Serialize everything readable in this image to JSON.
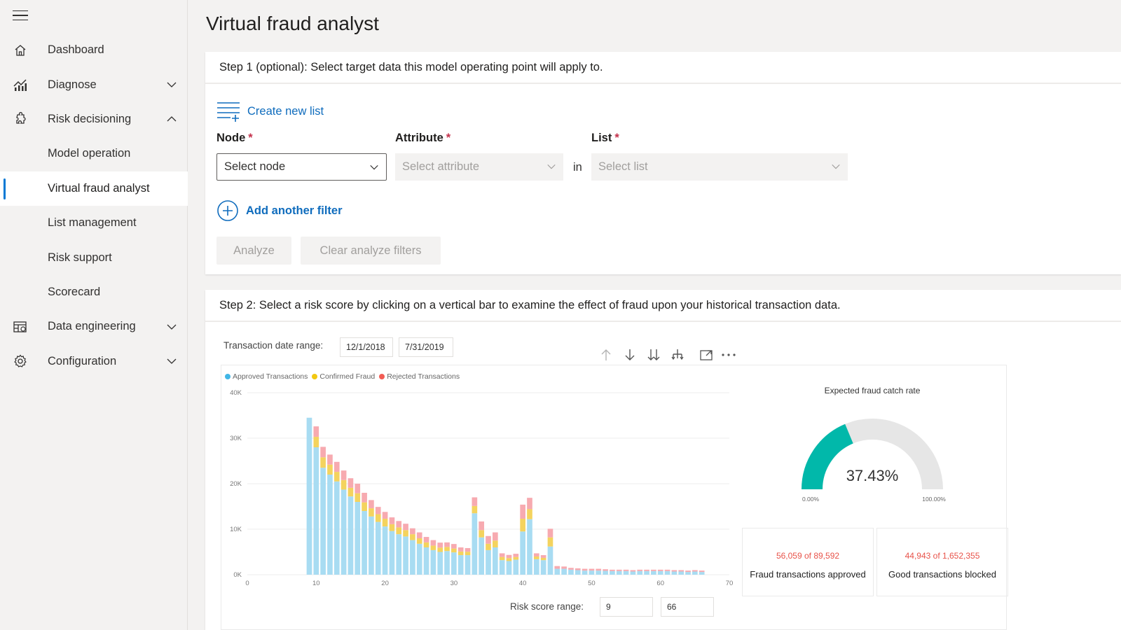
{
  "page": {
    "title": "Virtual fraud analyst"
  },
  "sidebar": {
    "items": [
      {
        "label": "Dashboard",
        "icon": "home-icon"
      },
      {
        "label": "Diagnose",
        "icon": "chart-icon",
        "chevron": "down"
      },
      {
        "label": "Risk decisioning",
        "icon": "puzzle-icon",
        "chevron": "up"
      },
      {
        "label": "Model operation"
      },
      {
        "label": "Virtual fraud analyst",
        "active": true
      },
      {
        "label": "List management"
      },
      {
        "label": "Risk support"
      },
      {
        "label": "Scorecard"
      },
      {
        "label": "Data engineering",
        "icon": "table-icon",
        "chevron": "down"
      },
      {
        "label": "Configuration",
        "icon": "gear-icon",
        "chevron": "down"
      }
    ]
  },
  "step1": {
    "heading": "Step 1 (optional): Select target data this model operating point will apply to.",
    "create_list": "Create new list",
    "node_label": "Node",
    "attribute_label": "Attribute",
    "list_label": "List",
    "required_mark": "*",
    "node_value": "Select node",
    "attribute_value": "Select attribute",
    "in_word": "in",
    "list_value": "Select list",
    "add_filter": "Add another filter",
    "analyze": "Analyze",
    "clear": "Clear analyze filters"
  },
  "step2": {
    "heading": "Step 2: Select a risk score by clicking on a vertical bar to examine the effect of fraud upon your historical transaction data.",
    "date_label": "Transaction date range:",
    "date_start": "12/1/2018",
    "date_end": "7/31/2019",
    "gauge_title": "Expected fraud catch rate",
    "gauge_value": "37.43%",
    "gauge_fraction": 0.3743,
    "gauge_min": "0.00%",
    "gauge_max": "100.00%",
    "kpi1_value": "56,059 of 89,592",
    "kpi1_label": "Fraud transactions approved",
    "kpi2_value": "44,943 of 1,652,355",
    "kpi2_label": "Good transactions blocked",
    "range_label": "Risk score range:",
    "range_min": "9",
    "range_max": "66"
  },
  "colors": {
    "accent": "#0078d4",
    "link": "#0f6cbd",
    "approved": "#a8dcf2",
    "confirmed": "#f4d35e",
    "rejected": "#f7aab0",
    "gauge_fill": "#01b8aa",
    "gauge_track": "#e6e6e6",
    "kpi_text": "#e8534a"
  },
  "chart_data": {
    "type": "bar",
    "stacked": true,
    "legend": [
      "Approved Transactions",
      "Confirmed Fraud",
      "Rejected Transactions"
    ],
    "legend_colors": [
      "#41b6e6",
      "#f2c811",
      "#f25c54"
    ],
    "x_ticks": [
      "0",
      "10",
      "20",
      "30",
      "40",
      "50",
      "60",
      "70"
    ],
    "y_ticks": [
      "0K",
      "10K",
      "20K",
      "30K",
      "40K"
    ],
    "xlim": [
      0,
      70
    ],
    "ylim": [
      0,
      40000
    ],
    "x": [
      9,
      10,
      11,
      12,
      13,
      14,
      15,
      16,
      17,
      18,
      19,
      20,
      21,
      22,
      23,
      24,
      25,
      26,
      27,
      28,
      29,
      30,
      31,
      32,
      33,
      34,
      35,
      36,
      37,
      38,
      39,
      40,
      41,
      42,
      43,
      44,
      45,
      46,
      47,
      48,
      49,
      50,
      51,
      52,
      53,
      54,
      55,
      56,
      57,
      58,
      59,
      60,
      61,
      62,
      63,
      64,
      65,
      66
    ],
    "series": [
      {
        "name": "Approved Transactions",
        "values": [
          34500,
          28000,
          23500,
          22000,
          20500,
          18700,
          17200,
          16000,
          14000,
          12800,
          11600,
          10600,
          9600,
          8900,
          8400,
          7600,
          6800,
          6000,
          5400,
          5000,
          5200,
          4900,
          4300,
          4300,
          13500,
          8200,
          5400,
          6000,
          3200,
          3000,
          3300,
          9500,
          12200,
          3400,
          3200,
          6200,
          1300,
          1300,
          1100,
          1000,
          900,
          900,
          900,
          850,
          800,
          800,
          800,
          700,
          800,
          800,
          800,
          800,
          800,
          700,
          700,
          600,
          700,
          600
        ]
      },
      {
        "name": "Confirmed Fraud",
        "values": [
          0,
          2300,
          2300,
          2200,
          2100,
          2100,
          1900,
          1900,
          1900,
          1800,
          1700,
          1700,
          1500,
          1500,
          1400,
          1300,
          1200,
          1100,
          1000,
          950,
          900,
          850,
          800,
          750,
          1600,
          1600,
          1400,
          1500,
          700,
          650,
          600,
          2800,
          2200,
          600,
          500,
          2000,
          0,
          0,
          0,
          0,
          0,
          0,
          0,
          0,
          0,
          0,
          0,
          0,
          0,
          0,
          0,
          0,
          0,
          0,
          0,
          0,
          0,
          0
        ]
      },
      {
        "name": "Rejected Transactions",
        "values": [
          0,
          2300,
          2300,
          2200,
          2200,
          2100,
          2100,
          2100,
          2100,
          1800,
          1600,
          1500,
          1500,
          1400,
          1400,
          1300,
          1300,
          1200,
          1200,
          1100,
          1000,
          1000,
          900,
          800,
          1900,
          1900,
          1700,
          1800,
          800,
          700,
          700,
          3100,
          2500,
          700,
          600,
          1900,
          600,
          500,
          400,
          400,
          400,
          400,
          400,
          350,
          300,
          300,
          300,
          300,
          300,
          300,
          300,
          300,
          300,
          300,
          300,
          300,
          300,
          300
        ]
      }
    ]
  }
}
